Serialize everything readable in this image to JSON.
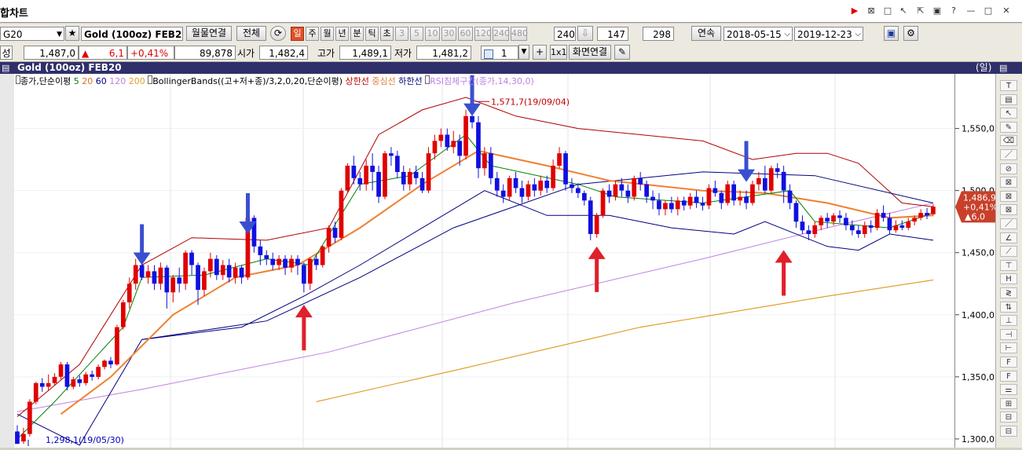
{
  "window": {
    "title": "합차트"
  },
  "toolbar1": {
    "symbol_code": "G20",
    "symbol_name": "Gold (100oz) FEB20",
    "monthly_link_btn": "월물연결",
    "all_btn": "전체",
    "periods": [
      "일",
      "주",
      "월",
      "년",
      "분",
      "틱",
      "초",
      "3",
      "5",
      "10",
      "30",
      "60",
      "120",
      "240",
      "480"
    ],
    "active_period": "일",
    "interval_value": "240",
    "count1": "147",
    "count2": "298",
    "continuous_btn": "연속",
    "date_from": "2018-05-15",
    "date_to": "2019-12-23"
  },
  "toolbar2": {
    "label_left": "성",
    "price": "1,487,0",
    "change": "6,1",
    "change_pct": "+0,41%",
    "volume": "89,878",
    "open_label": "시가",
    "open": "1,482,4",
    "high_label": "고가",
    "high": "1,489,1",
    "low_label": "저가",
    "low": "1,481,2",
    "spin_value": "1",
    "onexone": "1x1",
    "screen_link_btn": "화면연결"
  },
  "chart_header": {
    "title": "Gold (100oz) FEB20",
    "period": "(일)"
  },
  "legend": {
    "ma_label": "종가,단순이평",
    "ma_periods": [
      "5",
      "20",
      "60",
      "120",
      "200"
    ],
    "bb_label": "BollingerBands((고+저+종)/3,2,0,20,단순이평)",
    "bb_upper": "상한선",
    "bb_mid": "중심선",
    "bb_lower": "하한선",
    "rsi_label": "RSI침체구간(종가,14,30,0)"
  },
  "annotations": {
    "high_label": "1,571,7(19/09/04)",
    "low_label": "1,298,1(19/05/30)"
  },
  "price_badge": {
    "price": "1,486,9",
    "pct": "+0,41%",
    "chg": "▲6,0"
  },
  "right_tool_labels": [
    "T",
    "ALL",
    "",
    "",
    "",
    "",
    "",
    "",
    "",
    "",
    "",
    "",
    "",
    "",
    "",
    "",
    "",
    "",
    "",
    "",
    "",
    "",
    "",
    ""
  ],
  "colors": {
    "up": "#e00000",
    "down": "#1010e0",
    "ma5": "#008000",
    "ma20": "#f08030",
    "ma60": "#000080",
    "ma120": "#c080e0",
    "ma200": "#e0a030",
    "bb_upper": "#b00000",
    "bb_lower": "#000080",
    "arrow_blue": "#3a4fd0",
    "arrow_red": "#e0202a"
  },
  "chart_data": {
    "type": "candlestick",
    "title": "Gold (100oz) FEB20",
    "y_axis": {
      "ticks": [
        1300,
        1350,
        1400,
        1450,
        1500,
        1550
      ],
      "tick_labels": [
        "1,300,0",
        "1,350,0",
        "1,400,0",
        "1,450,0",
        "1,500,0",
        "1,550,0"
      ],
      "ylim": [
        1293,
        1594
      ]
    },
    "x_range": {
      "start": "2019-05-30",
      "end": "2019-12-23"
    },
    "candles": [
      [
        1306,
        1296,
        1311,
        1298
      ],
      [
        1298,
        1304,
        1309,
        1296
      ],
      [
        1304,
        1330,
        1332,
        1302
      ],
      [
        1330,
        1345,
        1346,
        1328
      ],
      [
        1345,
        1342,
        1349,
        1338
      ],
      [
        1342,
        1345,
        1352,
        1339
      ],
      [
        1345,
        1350,
        1353,
        1343
      ],
      [
        1350,
        1360,
        1362,
        1348
      ],
      [
        1360,
        1342,
        1362,
        1339
      ],
      [
        1342,
        1348,
        1350,
        1340
      ],
      [
        1348,
        1345,
        1351,
        1342
      ],
      [
        1345,
        1352,
        1354,
        1343
      ],
      [
        1352,
        1350,
        1355,
        1347
      ],
      [
        1350,
        1358,
        1360,
        1348
      ],
      [
        1358,
        1363,
        1364,
        1356
      ],
      [
        1363,
        1360,
        1366,
        1357
      ],
      [
        1360,
        1390,
        1392,
        1359
      ],
      [
        1390,
        1410,
        1412,
        1388
      ],
      [
        1410,
        1425,
        1430,
        1405
      ],
      [
        1425,
        1440,
        1445,
        1420
      ],
      [
        1440,
        1430,
        1452,
        1428
      ],
      [
        1430,
        1435,
        1440,
        1425
      ],
      [
        1435,
        1425,
        1440,
        1420
      ],
      [
        1425,
        1438,
        1442,
        1420
      ],
      [
        1438,
        1418,
        1440,
        1405
      ],
      [
        1418,
        1430,
        1432,
        1410
      ],
      [
        1430,
        1425,
        1438,
        1418
      ],
      [
        1425,
        1450,
        1452,
        1420
      ],
      [
        1450,
        1440,
        1452,
        1432
      ],
      [
        1440,
        1420,
        1442,
        1408
      ],
      [
        1420,
        1435,
        1438,
        1415
      ],
      [
        1435,
        1445,
        1450,
        1430
      ],
      [
        1445,
        1432,
        1448,
        1428
      ],
      [
        1432,
        1440,
        1444,
        1428
      ],
      [
        1440,
        1430,
        1445,
        1426
      ],
      [
        1430,
        1438,
        1442,
        1425
      ],
      [
        1438,
        1430,
        1440,
        1425
      ],
      [
        1430,
        1478,
        1480,
        1428
      ],
      [
        1478,
        1455,
        1480,
        1450
      ],
      [
        1455,
        1448,
        1460,
        1440
      ],
      [
        1448,
        1445,
        1452,
        1440
      ],
      [
        1445,
        1440,
        1450,
        1436
      ],
      [
        1440,
        1445,
        1448,
        1436
      ],
      [
        1445,
        1438,
        1448,
        1432
      ],
      [
        1438,
        1445,
        1448,
        1434
      ],
      [
        1445,
        1440,
        1448,
        1432
      ],
      [
        1440,
        1425,
        1442,
        1418
      ],
      [
        1425,
        1445,
        1446,
        1420
      ],
      [
        1445,
        1440,
        1448,
        1436
      ],
      [
        1440,
        1455,
        1456,
        1438
      ],
      [
        1455,
        1470,
        1472,
        1450
      ],
      [
        1470,
        1462,
        1475,
        1458
      ],
      [
        1462,
        1500,
        1502,
        1460
      ],
      [
        1500,
        1520,
        1522,
        1498
      ],
      [
        1520,
        1510,
        1528,
        1505
      ],
      [
        1510,
        1505,
        1515,
        1500
      ],
      [
        1505,
        1520,
        1525,
        1500
      ],
      [
        1520,
        1515,
        1530,
        1500
      ],
      [
        1515,
        1495,
        1520,
        1490
      ],
      [
        1495,
        1530,
        1532,
        1493
      ],
      [
        1530,
        1528,
        1535,
        1520
      ],
      [
        1528,
        1515,
        1532,
        1510
      ],
      [
        1515,
        1505,
        1520,
        1500
      ],
      [
        1505,
        1515,
        1518,
        1500
      ],
      [
        1515,
        1510,
        1520,
        1505
      ],
      [
        1510,
        1500,
        1515,
        1498
      ],
      [
        1500,
        1530,
        1535,
        1498
      ],
      [
        1530,
        1540,
        1545,
        1525
      ],
      [
        1540,
        1545,
        1550,
        1535
      ],
      [
        1545,
        1535,
        1550,
        1532
      ],
      [
        1535,
        1540,
        1548,
        1530
      ],
      [
        1540,
        1528,
        1545,
        1520
      ],
      [
        1528,
        1560,
        1565,
        1525
      ],
      [
        1560,
        1555,
        1572,
        1550
      ],
      [
        1555,
        1518,
        1560,
        1510
      ],
      [
        1518,
        1530,
        1535,
        1512
      ],
      [
        1530,
        1510,
        1535,
        1505
      ],
      [
        1510,
        1500,
        1515,
        1495
      ],
      [
        1500,
        1495,
        1505,
        1490
      ],
      [
        1495,
        1510,
        1512,
        1492
      ],
      [
        1510,
        1502,
        1515,
        1498
      ],
      [
        1502,
        1495,
        1508,
        1490
      ],
      [
        1495,
        1505,
        1508,
        1492
      ],
      [
        1505,
        1500,
        1510,
        1495
      ],
      [
        1500,
        1508,
        1512,
        1496
      ],
      [
        1508,
        1502,
        1512,
        1498
      ],
      [
        1502,
        1520,
        1525,
        1500
      ],
      [
        1520,
        1530,
        1535,
        1518
      ],
      [
        1530,
        1505,
        1532,
        1500
      ],
      [
        1505,
        1502,
        1510,
        1498
      ],
      [
        1502,
        1498,
        1506,
        1494
      ],
      [
        1498,
        1492,
        1500,
        1488
      ],
      [
        1492,
        1465,
        1495,
        1460
      ],
      [
        1465,
        1480,
        1482,
        1462
      ],
      [
        1480,
        1500,
        1502,
        1478
      ],
      [
        1500,
        1495,
        1505,
        1490
      ],
      [
        1495,
        1505,
        1508,
        1492
      ],
      [
        1505,
        1500,
        1510,
        1495
      ],
      [
        1500,
        1495,
        1505,
        1490
      ],
      [
        1495,
        1510,
        1512,
        1492
      ],
      [
        1510,
        1505,
        1515,
        1500
      ],
      [
        1505,
        1495,
        1508,
        1490
      ],
      [
        1495,
        1492,
        1500,
        1485
      ],
      [
        1492,
        1485,
        1498,
        1480
      ],
      [
        1485,
        1490,
        1492,
        1480
      ],
      [
        1490,
        1485,
        1495,
        1482
      ],
      [
        1485,
        1492,
        1495,
        1480
      ],
      [
        1492,
        1488,
        1495,
        1484
      ],
      [
        1488,
        1495,
        1498,
        1485
      ],
      [
        1495,
        1490,
        1500,
        1486
      ],
      [
        1490,
        1488,
        1495,
        1484
      ],
      [
        1488,
        1502,
        1505,
        1485
      ],
      [
        1502,
        1498,
        1508,
        1495
      ],
      [
        1498,
        1490,
        1500,
        1485
      ],
      [
        1490,
        1505,
        1508,
        1488
      ],
      [
        1505,
        1492,
        1508,
        1488
      ],
      [
        1492,
        1495,
        1500,
        1488
      ],
      [
        1495,
        1490,
        1500,
        1485
      ],
      [
        1490,
        1505,
        1508,
        1488
      ],
      [
        1505,
        1510,
        1515,
        1500
      ],
      [
        1510,
        1500,
        1520,
        1498
      ],
      [
        1500,
        1518,
        1520,
        1498
      ],
      [
        1518,
        1515,
        1522,
        1510
      ],
      [
        1515,
        1500,
        1520,
        1490
      ],
      [
        1500,
        1490,
        1505,
        1485
      ],
      [
        1490,
        1475,
        1492,
        1470
      ],
      [
        1475,
        1468,
        1480,
        1465
      ],
      [
        1468,
        1465,
        1472,
        1460
      ],
      [
        1465,
        1472,
        1475,
        1462
      ],
      [
        1472,
        1478,
        1480,
        1468
      ],
      [
        1478,
        1475,
        1482,
        1470
      ],
      [
        1475,
        1480,
        1482,
        1472
      ],
      [
        1480,
        1478,
        1484,
        1474
      ],
      [
        1478,
        1472,
        1482,
        1468
      ],
      [
        1472,
        1468,
        1476,
        1464
      ],
      [
        1468,
        1465,
        1472,
        1462
      ],
      [
        1465,
        1472,
        1475,
        1462
      ],
      [
        1472,
        1470,
        1476,
        1466
      ],
      [
        1470,
        1482,
        1485,
        1468
      ],
      [
        1482,
        1478,
        1488,
        1475
      ],
      [
        1478,
        1468,
        1482,
        1465
      ],
      [
        1468,
        1472,
        1476,
        1466
      ],
      [
        1472,
        1470,
        1476,
        1468
      ],
      [
        1470,
        1475,
        1478,
        1468
      ],
      [
        1475,
        1478,
        1480,
        1472
      ],
      [
        1478,
        1482,
        1485,
        1476
      ],
      [
        1482,
        1480,
        1486,
        1477
      ],
      [
        1481,
        1487,
        1489,
        1480
      ]
    ],
    "ma5": [
      [
        0,
        1300
      ],
      [
        6,
        1330
      ],
      [
        17,
        1390
      ],
      [
        20,
        1430
      ],
      [
        30,
        1432
      ],
      [
        40,
        1445
      ],
      [
        47,
        1440
      ],
      [
        55,
        1505
      ],
      [
        63,
        1512
      ],
      [
        72,
        1545
      ],
      [
        76,
        1520
      ],
      [
        90,
        1505
      ],
      [
        96,
        1495
      ],
      [
        110,
        1490
      ],
      [
        124,
        1500
      ],
      [
        128,
        1475
      ],
      [
        140,
        1470
      ],
      [
        147,
        1482
      ]
    ],
    "ma20": [
      [
        7,
        1320
      ],
      [
        15,
        1350
      ],
      [
        25,
        1400
      ],
      [
        35,
        1430
      ],
      [
        45,
        1440
      ],
      [
        55,
        1470
      ],
      [
        65,
        1505
      ],
      [
        74,
        1532
      ],
      [
        85,
        1520
      ],
      [
        95,
        1508
      ],
      [
        110,
        1500
      ],
      [
        120,
        1498
      ],
      [
        130,
        1490
      ],
      [
        140,
        1478
      ],
      [
        147,
        1480
      ]
    ],
    "ma60": [
      [
        20,
        1380
      ],
      [
        40,
        1395
      ],
      [
        55,
        1430
      ],
      [
        70,
        1470
      ],
      [
        90,
        1505
      ],
      [
        110,
        1515
      ],
      [
        128,
        1512
      ],
      [
        147,
        1490
      ]
    ],
    "ma120": [
      [
        0,
        1322
      ],
      [
        20,
        1340
      ],
      [
        50,
        1370
      ],
      [
        80,
        1410
      ],
      [
        110,
        1445
      ],
      [
        130,
        1470
      ],
      [
        147,
        1490
      ]
    ],
    "ma200": [
      [
        48,
        1330
      ],
      [
        70,
        1355
      ],
      [
        100,
        1390
      ],
      [
        130,
        1415
      ],
      [
        147,
        1428
      ]
    ],
    "bb_upper": [
      [
        0,
        1318
      ],
      [
        10,
        1360
      ],
      [
        20,
        1440
      ],
      [
        28,
        1462
      ],
      [
        40,
        1460
      ],
      [
        50,
        1470
      ],
      [
        58,
        1545
      ],
      [
        65,
        1565
      ],
      [
        72,
        1575
      ],
      [
        80,
        1560
      ],
      [
        90,
        1550
      ],
      [
        100,
        1545
      ],
      [
        110,
        1540
      ],
      [
        118,
        1525
      ],
      [
        125,
        1530
      ],
      [
        130,
        1530
      ],
      [
        135,
        1522
      ],
      [
        142,
        1490
      ],
      [
        147,
        1487
      ]
    ],
    "bb_lower": [
      [
        0,
        1320
      ],
      [
        10,
        1295
      ],
      [
        20,
        1380
      ],
      [
        28,
        1385
      ],
      [
        36,
        1390
      ],
      [
        46,
        1415
      ],
      [
        55,
        1440
      ],
      [
        65,
        1470
      ],
      [
        75,
        1500
      ],
      [
        85,
        1480
      ],
      [
        95,
        1480
      ],
      [
        105,
        1470
      ],
      [
        115,
        1465
      ],
      [
        120,
        1475
      ],
      [
        130,
        1455
      ],
      [
        135,
        1452
      ],
      [
        140,
        1465
      ],
      [
        147,
        1460
      ]
    ],
    "arrows": [
      {
        "type": "down",
        "index": 20,
        "price": 1465
      },
      {
        "type": "down",
        "index": 37,
        "price": 1490
      },
      {
        "type": "up",
        "index": 46,
        "price": 1408
      },
      {
        "type": "down",
        "index": 73,
        "price": 1585
      },
      {
        "type": "up",
        "index": 93,
        "price": 1455
      },
      {
        "type": "down",
        "index": 117,
        "price": 1532
      },
      {
        "type": "up",
        "index": 123,
        "price": 1452
      }
    ]
  }
}
